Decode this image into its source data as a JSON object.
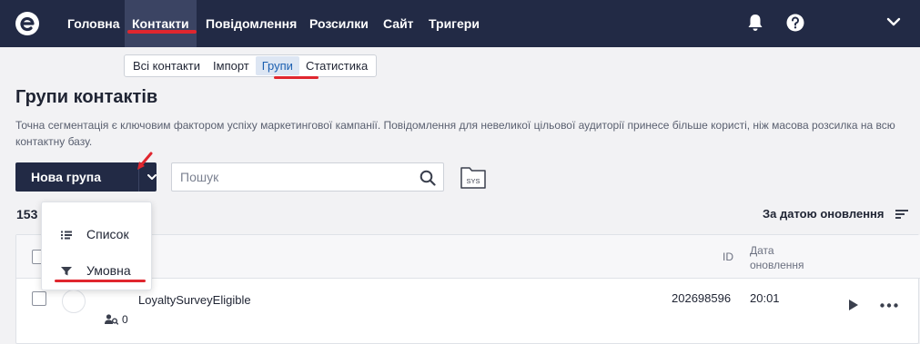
{
  "nav": {
    "items": [
      "Головна",
      "Контакти",
      "Повідомлення",
      "Розсилки",
      "Сайт",
      "Тригери"
    ],
    "active_index": 1
  },
  "subtabs": {
    "items": [
      "Всі контакти",
      "Імпорт",
      "Групи",
      "Статистика"
    ],
    "active_index": 2
  },
  "page": {
    "title": "Групи контактів",
    "description": "Точна сегментація є ключовим фактором успіху маркетингової кампанії. Повідомлення для невеликої цільової аудиторії принесе більше користі, ніж масова розсилка на всю контактну базу."
  },
  "toolbar": {
    "new_group_label": "Нова група",
    "search_placeholder": "Пошук",
    "sys_label": "SYS"
  },
  "list": {
    "count": "153",
    "sort_label": "За датою оновлення",
    "columns": {
      "id": "ID",
      "date_line1": "Дата",
      "date_line2": "оновлення"
    },
    "rows": [
      {
        "name": "LoyaltySurveyEligible",
        "contacts": "0",
        "id": "202698596",
        "date": "20:01"
      }
    ]
  },
  "dropdown": {
    "items": [
      "Список",
      "Умовна"
    ]
  },
  "colors": {
    "nav_bg": "#222a45",
    "accent_red": "#e0262e",
    "active_tab_text": "#1b5fb0"
  }
}
